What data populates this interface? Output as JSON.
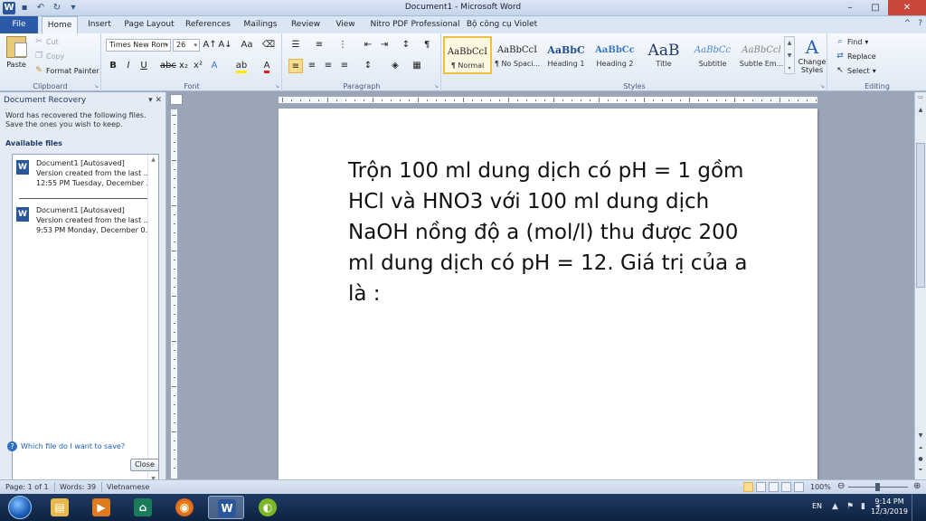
{
  "window": {
    "title": "Document1 - Microsoft Word",
    "app_icon": "W",
    "controls": [
      "minimize-icon",
      "maximize-icon",
      "close-icon"
    ]
  },
  "ribbon_tabs": [
    "File",
    "Home",
    "Insert",
    "Page Layout",
    "References",
    "Mailings",
    "Review",
    "View",
    "Nitro PDF Professional",
    "Bộ công cụ Violet"
  ],
  "ribbon_tabs_active": "Home",
  "clipboard": {
    "paste": "Paste",
    "cut": "Cut",
    "copy": "Copy",
    "format_painter": "Format Painter",
    "label": "Clipboard"
  },
  "font": {
    "name": "Times New Rom",
    "size": "26",
    "label": "Font"
  },
  "paragraph": {
    "label": "Paragraph"
  },
  "styles": {
    "label": "Styles",
    "items": [
      {
        "sample": "AaBbCcI",
        "name": "¶ Normal"
      },
      {
        "sample": "AaBbCcI",
        "name": "¶ No Spaci..."
      },
      {
        "sample": "AaBbC",
        "name": "Heading 1"
      },
      {
        "sample": "AaBbCc",
        "name": "Heading 2"
      },
      {
        "sample": "AaB",
        "name": "Title"
      },
      {
        "sample": "AaBbCc",
        "name": "Subtitle"
      },
      {
        "sample": "AaBbCcl",
        "name": "Subtle Em..."
      }
    ],
    "change_styles": "Change Styles"
  },
  "editing": {
    "label": "Editing",
    "find": "Find",
    "replace": "Replace",
    "select": "Select"
  },
  "recovery": {
    "title": "Document Recovery",
    "message": "Word has recovered the following files. Save the ones you wish to keep.",
    "available": "Available files",
    "files": [
      {
        "name": "Document1  [Autosaved]",
        "line2": "Version created from the last ...",
        "line3": "12:55 PM Tuesday, December ..."
      },
      {
        "name": "Document1  [Autosaved]",
        "line2": "Version created from the last ...",
        "line3": "9:53 PM Monday, December 0..."
      }
    ],
    "help_link": "Which file do I want to save?",
    "close": "Close"
  },
  "document": {
    "text": "Trộn 100 ml dung dịch có pH = 1 gồm HCl và HNO3 với 100 ml dung dịch NaOH nồng độ a (mol/l) thu được 200 ml dung dịch có pH = 12. Giá trị của a là :"
  },
  "status": {
    "page": "Page: 1 of 1",
    "words": "Words: 39",
    "language": "Vietnamese",
    "zoom": "100%"
  },
  "taskbar": {
    "lang": "EN",
    "time": "9:14 PM",
    "date": "12/3/2019"
  }
}
